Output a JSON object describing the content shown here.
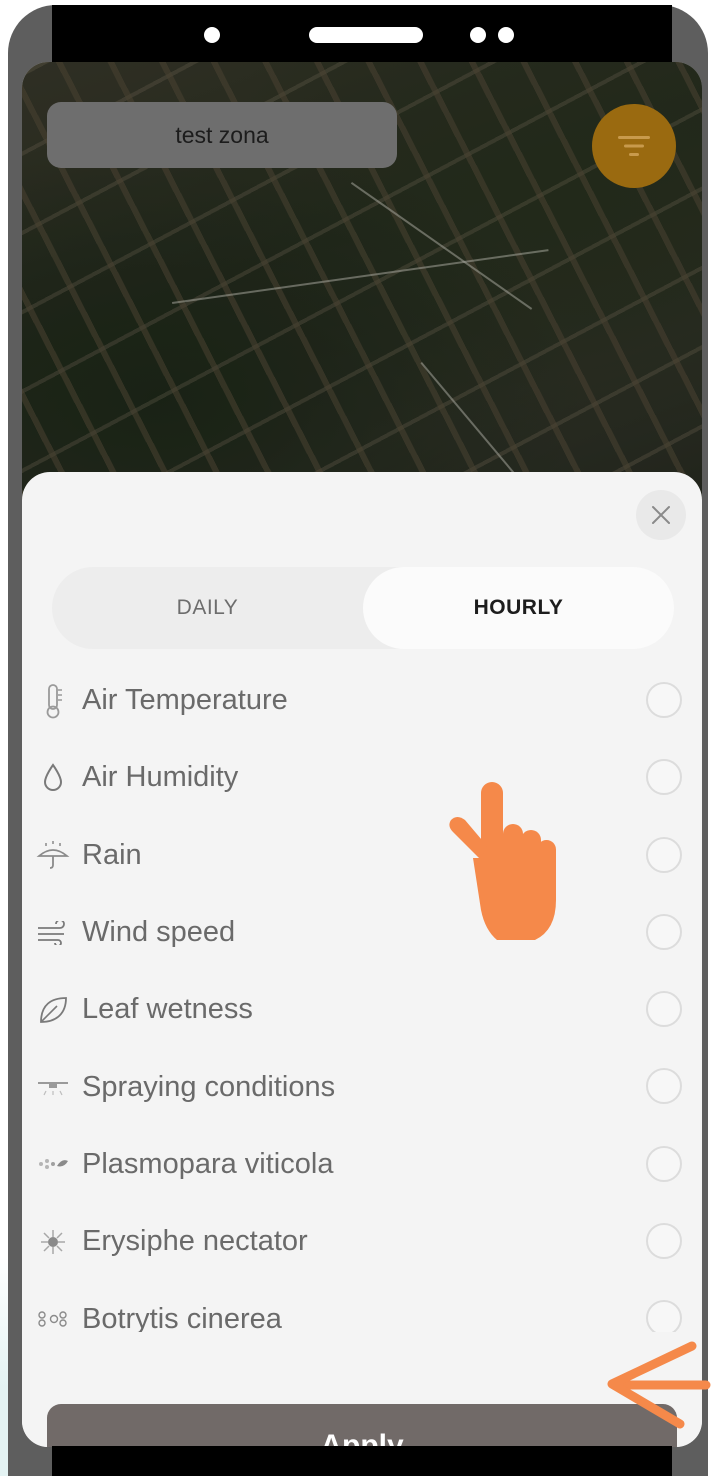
{
  "map": {
    "zone_name": "test zona"
  },
  "sheet": {
    "tabs": [
      {
        "label": "DAILY",
        "active": false
      },
      {
        "label": "HOURLY",
        "active": true
      }
    ],
    "items": [
      {
        "label": "Air Temperature",
        "icon": "thermometer-icon",
        "selected": false
      },
      {
        "label": "Air Humidity",
        "icon": "water-drop-icon",
        "selected": false
      },
      {
        "label": "Rain",
        "icon": "umbrella-rain-icon",
        "selected": false
      },
      {
        "label": "Wind speed",
        "icon": "wind-icon",
        "selected": false
      },
      {
        "label": "Leaf wetness",
        "icon": "leaf-icon",
        "selected": false
      },
      {
        "label": "Spraying conditions",
        "icon": "sprayer-drone-icon",
        "selected": false
      },
      {
        "label": "Plasmopara viticola",
        "icon": "plasmopara-disease-icon",
        "selected": false
      },
      {
        "label": "Erysiphe nectator",
        "icon": "erysiphe-disease-icon",
        "selected": false
      },
      {
        "label": "Botrytis cinerea",
        "icon": "botrytis-disease-icon",
        "selected": false
      }
    ],
    "apply_label": "Apply"
  },
  "colors": {
    "accent_orange": "#f5894a",
    "apply_button": "#716a68",
    "filter_fab": "#9a6a10"
  }
}
